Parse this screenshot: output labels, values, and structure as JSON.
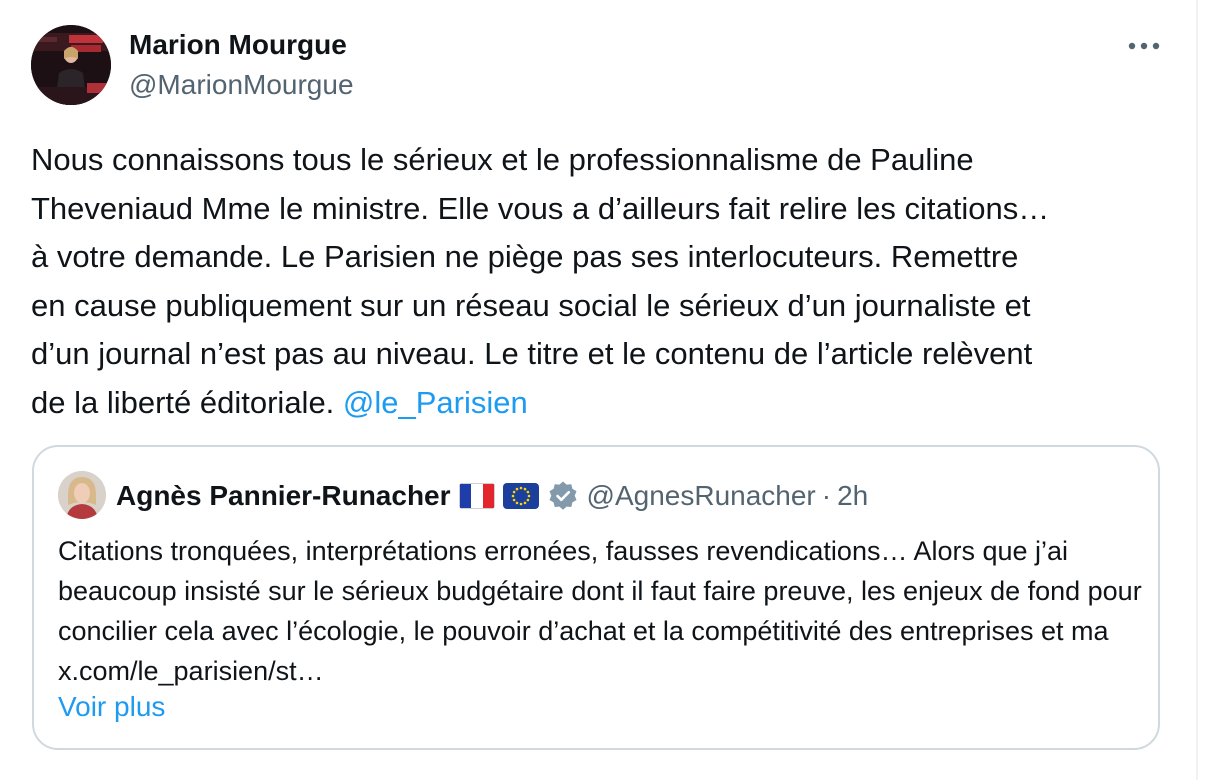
{
  "tweet": {
    "author": {
      "name": "Marion Mourgue",
      "handle": "@MarionMourgue"
    },
    "text_before_mention": "Nous connaissons tous le sérieux et le professionnalisme de Pauline\nTheveniaud Mme le ministre. Elle vous a d’ailleurs fait relire les citations…\nà votre demande. Le Parisien ne piège pas ses interlocuteurs. Remettre\nen cause publiquement sur un réseau social le sérieux d’un journaliste et\nd’un journal n’est pas au niveau. Le titre et le contenu de l’article relèvent\nde la liberté éditoriale. ",
    "mention": "@le_Parisien",
    "more_icon": "more-dots-icon"
  },
  "quote": {
    "author": {
      "name": "Agnès Pannier-Runacher",
      "flags": [
        "flag-france-icon",
        "flag-eu-icon"
      ],
      "verified_icon": "verified-badge-icon",
      "handle": "@AgnesRunacher",
      "separator": "·",
      "time": "2h"
    },
    "text": "Citations tronquées, interprétations erronées, fausses revendications… Alors que j’ai beaucoup insisté sur le sérieux budgétaire dont il faut faire preuve, les enjeux de fond pour concilier cela avec l’écologie, le pouvoir d’achat et la compétitivité des entreprises et ma x.com/le_parisien/st…",
    "show_more": "Voir plus"
  },
  "colors": {
    "text": "#0f1419",
    "secondary": "#536471",
    "accent": "#1d9bf0",
    "border": "#cfd9de"
  }
}
